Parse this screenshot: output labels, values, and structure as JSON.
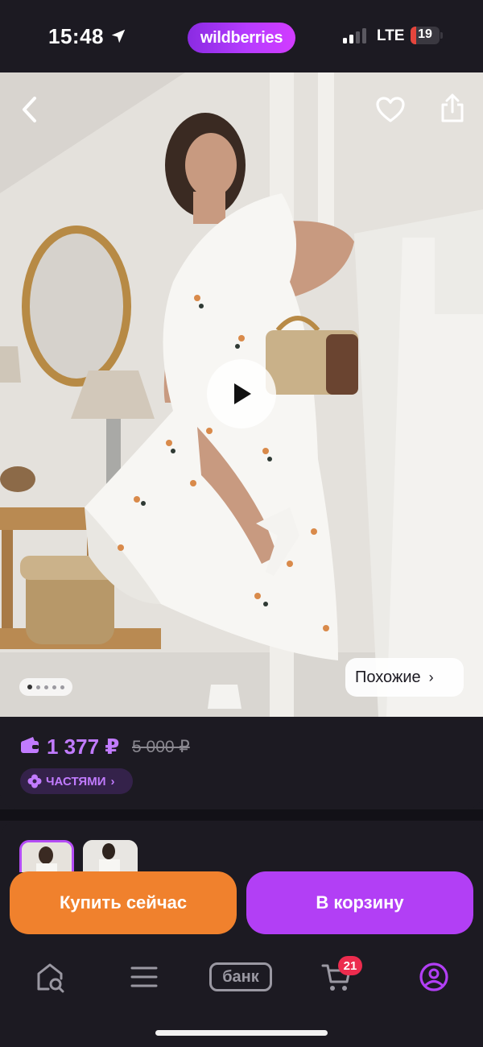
{
  "status_bar": {
    "time": "15:48",
    "brand": "wildberries",
    "network": "LTE",
    "battery_level": "19",
    "battery_fraction": 0.19
  },
  "product_photo": {
    "back_icon": "chevron-left-icon",
    "favorite_icon": "heart-icon",
    "share_icon": "share-icon",
    "play_icon": "play-icon",
    "gallery": {
      "total": 5,
      "active": 1
    },
    "similar_label": "Похожие",
    "similar_chevron": "›"
  },
  "price": {
    "current": "1 377 ₽",
    "old": "5 000 ₽",
    "installments_label": "ЧАСТЯМИ",
    "installments_chevron": "›",
    "accent_color": "#c17bff"
  },
  "actions": {
    "buy_now": "Купить сейчас",
    "add_to_cart": "В корзину",
    "buy_color": "#f0812d",
    "cart_color": "#b23ff5"
  },
  "tab_bar": {
    "items": [
      {
        "name": "home",
        "icon": "home-search-icon"
      },
      {
        "name": "catalog",
        "icon": "menu-icon"
      },
      {
        "name": "bank",
        "label": "банк"
      },
      {
        "name": "cart",
        "icon": "cart-icon",
        "badge": "21"
      },
      {
        "name": "profile",
        "icon": "profile-icon"
      }
    ]
  }
}
